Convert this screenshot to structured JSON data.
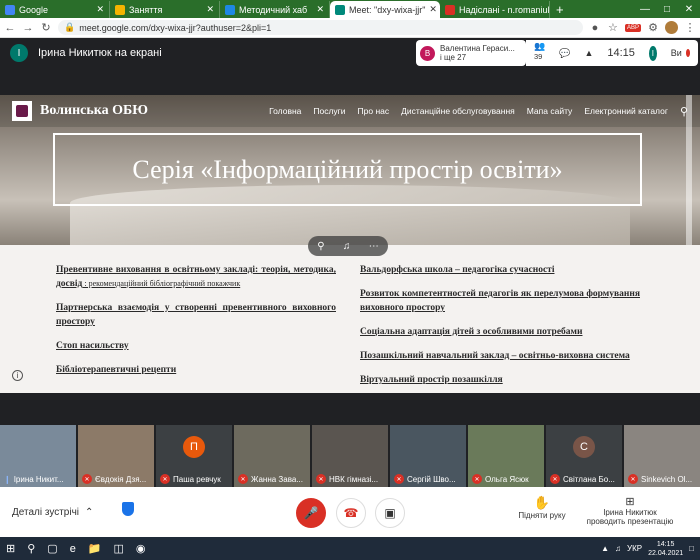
{
  "browser": {
    "tabs": [
      {
        "title": "Google",
        "color": "#4285f4",
        "active": false
      },
      {
        "title": "Заняття",
        "color": "#f4b400",
        "active": false
      },
      {
        "title": "Методичний хаб",
        "color": "#1e88e5",
        "active": false
      },
      {
        "title": "Meet: \"dxy-wixa-jjr\"",
        "color": "#00897b",
        "active": true
      },
      {
        "title": "Надіслані - n.romaniuk@",
        "color": "#d93025",
        "active": false
      }
    ],
    "new_tab": "+",
    "url": "meet.google.com/dxy-wixa-jjr?authuser=2&pli=1",
    "abp_label": "ABP"
  },
  "meet": {
    "presenter_initial": "І",
    "presenter_label": "Ірина Никитюк на екрані",
    "speaker_initial": "В",
    "speaker_name": "Валентина Гераси...",
    "speaker_more": "і ще 27",
    "participants_count": "39",
    "time": "14:15",
    "self_initial": "І",
    "self_label": "Ви"
  },
  "slide": {
    "brand": "Волинська ОБЮ",
    "nav": [
      "Головна",
      "Послуги",
      "Про нас",
      "Дистанційне обслуговування",
      "Мапа сайту",
      "Електронний каталог"
    ],
    "banner_title": "Серія «Інформаційний простір освіти»",
    "left_links": [
      {
        "text": "Превентивне виховання в освітньому закладі: теорія, методика, досвід",
        "sub": " : рекомендаційний бібліографічний покажчик"
      },
      {
        "text": "Партнерська взаємодія у створенні превентивного виховного простору",
        "sub": ""
      },
      {
        "text": "Стоп насильству",
        "sub": ""
      },
      {
        "text": "Бібліотерапевтичні рецепти",
        "sub": ""
      }
    ],
    "right_links": [
      {
        "text": "Вальдорфська школа – педагогіка сучасності"
      },
      {
        "text": "Розвиток компетентностей педагогів як перелумова формування виховного простору"
      },
      {
        "text": "Соціальна адаптація дітей з особливими потребами"
      },
      {
        "text": "Позашкільний навчальний заклад – освітньо-виховна система"
      },
      {
        "text": "Віртуальний простір позашкілля"
      }
    ]
  },
  "tiles": [
    {
      "name": "Ірина Никит...",
      "muted": false,
      "bg": "#7a8a9a",
      "letter": "",
      "letter_color": ""
    },
    {
      "name": "Євдокія Дзя...",
      "muted": true,
      "bg": "#8c7a68",
      "letter": "",
      "letter_color": ""
    },
    {
      "name": "Паша ревчук",
      "muted": true,
      "bg": "#3c4043",
      "letter": "П",
      "letter_color": "#e8590c"
    },
    {
      "name": "Жанна Зава...",
      "muted": true,
      "bg": "#6d6a5e",
      "letter": "",
      "letter_color": ""
    },
    {
      "name": "НВК гімназі...",
      "muted": true,
      "bg": "#5a5550",
      "letter": "",
      "letter_color": ""
    },
    {
      "name": "Сергій Шво...",
      "muted": true,
      "bg": "#4a5660",
      "letter": "",
      "letter_color": ""
    },
    {
      "name": "Ольга Ясюк",
      "muted": true,
      "bg": "#6a7a5a",
      "letter": "",
      "letter_color": ""
    },
    {
      "name": "Світлана Бо...",
      "muted": true,
      "bg": "#3c4043",
      "letter": "С",
      "letter_color": "#795548"
    },
    {
      "name": "Sinkevich Ol...",
      "muted": true,
      "bg": "#8a8580",
      "letter": "",
      "letter_color": ""
    }
  ],
  "controls": {
    "details_label": "Деталі зустрічі",
    "raise_hand": "Підняти руку",
    "presenter_line1": "Ірина Никитюк",
    "presenter_line2": "проводить презентацію"
  },
  "taskbar": {
    "lang": "УКР",
    "time": "14:15",
    "date": "22.04.2021"
  }
}
